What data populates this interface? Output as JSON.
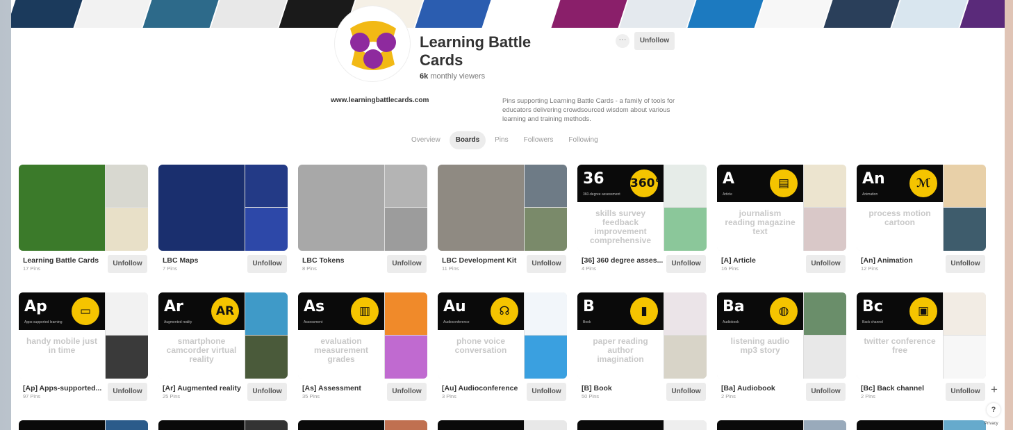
{
  "profile": {
    "name": "Learning Battle Cards",
    "viewers_count": "6k",
    "viewers_label": "monthly viewers",
    "more_glyph": "···",
    "unfollow_label": "Unfollow",
    "website": "www.learningbattlecards.com",
    "bio": "Pins supporting Learning Battle Cards - a family of tools for educators delivering crowdsourced wisdom about various learning and training methods."
  },
  "tabs": [
    "Overview",
    "Boards",
    "Pins",
    "Followers",
    "Following"
  ],
  "active_tab": "Boards",
  "colors": {
    "card_black": "#0a0a0a",
    "card_yellow": "#f5c400",
    "logo_purple": "#8e2a9e",
    "logo_yellow": "#f2b915",
    "button_bg": "#ececec"
  },
  "board_button_label": "Unfollow",
  "boards_row1": [
    {
      "title": "Learning Battle Cards",
      "pins": "17 Pins",
      "style": "photo",
      "c1": "#3b7a2a",
      "c2": "#d8d8d0",
      "c3": "#e8e0c8"
    },
    {
      "title": "LBC Maps",
      "pins": "7 Pins",
      "style": "photo",
      "c1": "#1a2f6e",
      "c2": "#233a86",
      "c3": "#2d48a8"
    },
    {
      "title": "LBC Tokens",
      "pins": "8 Pins",
      "style": "photo",
      "c1": "#a8a8a8",
      "c2": "#b4b4b4",
      "c3": "#9c9c9c"
    },
    {
      "title": "LBC Development Kit",
      "pins": "11 Pins",
      "style": "photo",
      "c1": "#8f8a82",
      "c2": "#6e7b86",
      "c3": "#7a8a6a"
    },
    {
      "title": "[36] 360 degree asses...",
      "pins": "4 Pins",
      "style": "card",
      "code": "36",
      "icon": "360°",
      "sub": "360-degree assessment",
      "words": "skills survey feedback improvement comprehensive",
      "c2": "#e6ece8",
      "c3": "#8bc79a"
    },
    {
      "title": "[A] Article",
      "pins": "16 Pins",
      "style": "card",
      "code": "A",
      "icon": "▤",
      "sub": "Article",
      "words": "journalism reading magazine text",
      "c2": "#ece4cf",
      "c3": "#d9c8c8"
    },
    {
      "title": "[An] Animation",
      "pins": "12 Pins",
      "style": "card",
      "code": "An",
      "icon": "ℳ",
      "sub": "Animation",
      "words": "process motion cartoon",
      "c2": "#e8d0a8",
      "c3": "#3e5c6c"
    }
  ],
  "boards_row2": [
    {
      "title": "[Ap] Apps-supported...",
      "pins": "97 Pins",
      "style": "card",
      "code": "Ap",
      "icon": "▭",
      "sub": "Apps-supported learning",
      "words": "handy mobile just in time",
      "c2": "#f2f2f2",
      "c3": "#3a3a3a"
    },
    {
      "title": "[Ar] Augmented reality",
      "pins": "25 Pins",
      "style": "card",
      "code": "Ar",
      "icon": "AR",
      "sub": "Augmented reality",
      "words": "smartphone camcorder virtual reality",
      "c2": "#3f9ac8",
      "c3": "#4a5a3a"
    },
    {
      "title": "[As] Assessment",
      "pins": "35 Pins",
      "style": "card",
      "code": "As",
      "icon": "▥",
      "sub": "Assessment",
      "words": "evaluation measurement grades",
      "c2": "#f08a2a",
      "c3": "#c06ad0"
    },
    {
      "title": "[Au] Audioconference",
      "pins": "3 Pins",
      "style": "card",
      "code": "Au",
      "icon": "☊",
      "sub": "Audioconference",
      "words": "phone voice conversation",
      "c2": "#f2f6fa",
      "c3": "#3aa0e0"
    },
    {
      "title": "[B] Book",
      "pins": "50 Pins",
      "style": "card",
      "code": "B",
      "icon": "▮",
      "sub": "Book",
      "words": "paper reading author imagination",
      "c2": "#ebe4e8",
      "c3": "#d8d4c8"
    },
    {
      "title": "[Ba] Audiobook",
      "pins": "2 Pins",
      "style": "card",
      "code": "Ba",
      "icon": "◍",
      "sub": "Audiobook",
      "words": "listening audio mp3 story",
      "c2": "#6a8e6a",
      "c3": "#e8e8e8"
    },
    {
      "title": "[Bc] Back channel",
      "pins": "2 Pins",
      "style": "card",
      "code": "Bc",
      "icon": "▣",
      "sub": "Back channel",
      "words": "twitter conference free",
      "c2": "#f2ece4",
      "c3": "#f7f7f7"
    }
  ],
  "ui": {
    "plus": "+",
    "help": "?",
    "privacy": "Privacy"
  }
}
